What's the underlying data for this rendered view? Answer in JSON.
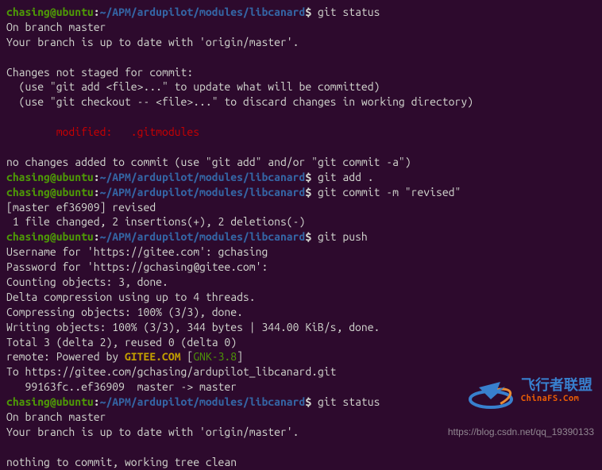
{
  "prompt": {
    "user_host": "chasing@ubuntu",
    "separator": ":",
    "path": "~/APM/ardupilot/modules/libcanard",
    "dollar": "$"
  },
  "lines": [
    {
      "type": "prompt",
      "cmd": "git status"
    },
    {
      "type": "out",
      "text": "On branch master"
    },
    {
      "type": "out",
      "text": "Your branch is up to date with 'origin/master'."
    },
    {
      "type": "blank"
    },
    {
      "type": "out",
      "text": "Changes not staged for commit:"
    },
    {
      "type": "out",
      "text": "  (use \"git add <file>...\" to update what will be committed)"
    },
    {
      "type": "out",
      "text": "  (use \"git checkout -- <file>...\" to discard changes in working directory)"
    },
    {
      "type": "blank"
    },
    {
      "type": "red",
      "text": "        modified:   .gitmodules"
    },
    {
      "type": "blank"
    },
    {
      "type": "out",
      "text": "no changes added to commit (use \"git add\" and/or \"git commit -a\")"
    },
    {
      "type": "prompt",
      "cmd": "git add ."
    },
    {
      "type": "prompt",
      "cmd": "git commit -m \"revised\""
    },
    {
      "type": "out",
      "text": "[master ef36909] revised"
    },
    {
      "type": "out",
      "text": " 1 file changed, 2 insertions(+), 2 deletions(-)"
    },
    {
      "type": "prompt",
      "cmd": "git push"
    },
    {
      "type": "out",
      "text": "Username for 'https://gitee.com': gchasing"
    },
    {
      "type": "out",
      "text": "Password for 'https://gchasing@gitee.com':"
    },
    {
      "type": "out",
      "text": "Counting objects: 3, done."
    },
    {
      "type": "out",
      "text": "Delta compression using up to 4 threads."
    },
    {
      "type": "out",
      "text": "Compressing objects: 100% (3/3), done."
    },
    {
      "type": "out",
      "text": "Writing objects: 100% (3/3), 344 bytes | 344.00 KiB/s, done."
    },
    {
      "type": "out",
      "text": "Total 3 (delta 2), reused 0 (delta 0)"
    },
    {
      "type": "remote",
      "pre": "remote: Powered by ",
      "brand": "GITEE.COM",
      "open": " [",
      "gnk": "GNK-3.8",
      "close": "]"
    },
    {
      "type": "out",
      "text": "To https://gitee.com/gchasing/ardupilot_libcanard.git"
    },
    {
      "type": "out",
      "text": "   99163fc..ef36909  master -> master"
    },
    {
      "type": "prompt",
      "cmd": "git status"
    },
    {
      "type": "out",
      "text": "On branch master"
    },
    {
      "type": "out",
      "text": "Your branch is up to date with 'origin/master'."
    },
    {
      "type": "blank"
    },
    {
      "type": "out",
      "text": "nothing to commit, working tree clean"
    }
  ],
  "watermark": {
    "title": "飞行者联盟",
    "subtitle": "ChinaFS.Com",
    "url": "https://blog.csdn.net/qq_19390133"
  }
}
